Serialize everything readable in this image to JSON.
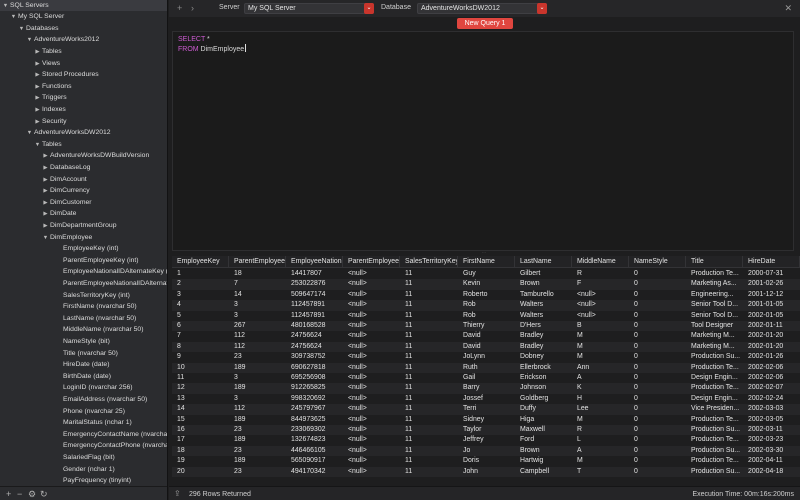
{
  "sidebar": {
    "tree": [
      {
        "label": "SQL Servers",
        "arrow": "▼",
        "indent": 0,
        "selected": true
      },
      {
        "label": "My SQL Server",
        "arrow": "▼",
        "indent": 1
      },
      {
        "label": "Databases",
        "arrow": "▼",
        "indent": 2
      },
      {
        "label": "AdventureWorks2012",
        "arrow": "▼",
        "indent": 3
      },
      {
        "label": "Tables",
        "arrow": "▶",
        "indent": 4
      },
      {
        "label": "Views",
        "arrow": "▶",
        "indent": 4
      },
      {
        "label": "Stored Procedures",
        "arrow": "▶",
        "indent": 4
      },
      {
        "label": "Functions",
        "arrow": "▶",
        "indent": 4
      },
      {
        "label": "Triggers",
        "arrow": "▶",
        "indent": 4
      },
      {
        "label": "Indexes",
        "arrow": "▶",
        "indent": 4
      },
      {
        "label": "Security",
        "arrow": "▶",
        "indent": 4
      },
      {
        "label": "AdventureWorksDW2012",
        "arrow": "▼",
        "indent": 3
      },
      {
        "label": "Tables",
        "arrow": "▼",
        "indent": 4
      },
      {
        "label": "AdventureWorksDWBuildVersion",
        "arrow": "▶",
        "indent": 5
      },
      {
        "label": "DatabaseLog",
        "arrow": "▶",
        "indent": 5
      },
      {
        "label": "DimAccount",
        "arrow": "▶",
        "indent": 5
      },
      {
        "label": "DimCurrency",
        "arrow": "▶",
        "indent": 5
      },
      {
        "label": "DimCustomer",
        "arrow": "▶",
        "indent": 5
      },
      {
        "label": "DimDate",
        "arrow": "▶",
        "indent": 5
      },
      {
        "label": "DimDepartmentGroup",
        "arrow": "▶",
        "indent": 5
      },
      {
        "label": "DimEmployee",
        "arrow": "▼",
        "indent": 5
      },
      {
        "label": "EmployeeKey (int)",
        "arrow": "",
        "indent": 6
      },
      {
        "label": "ParentEmployeeKey (int)",
        "arrow": "",
        "indent": 6
      },
      {
        "label": "EmployeeNationalIDAlternateKey (...",
        "arrow": "",
        "indent": 6
      },
      {
        "label": "ParentEmployeeNationalIDAlternat...",
        "arrow": "",
        "indent": 6
      },
      {
        "label": "SalesTerritoryKey (int)",
        "arrow": "",
        "indent": 6
      },
      {
        "label": "FirstName (nvarchar 50)",
        "arrow": "",
        "indent": 6
      },
      {
        "label": "LastName (nvarchar 50)",
        "arrow": "",
        "indent": 6
      },
      {
        "label": "MiddleName (nvarchar 50)",
        "arrow": "",
        "indent": 6
      },
      {
        "label": "NameStyle (bit)",
        "arrow": "",
        "indent": 6
      },
      {
        "label": "Title (nvarchar 50)",
        "arrow": "",
        "indent": 6
      },
      {
        "label": "HireDate (date)",
        "arrow": "",
        "indent": 6
      },
      {
        "label": "BirthDate (date)",
        "arrow": "",
        "indent": 6
      },
      {
        "label": "LoginID (nvarchar 256)",
        "arrow": "",
        "indent": 6
      },
      {
        "label": "EmailAddress (nvarchar 50)",
        "arrow": "",
        "indent": 6
      },
      {
        "label": "Phone (nvarchar 25)",
        "arrow": "",
        "indent": 6
      },
      {
        "label": "MaritalStatus (nchar 1)",
        "arrow": "",
        "indent": 6
      },
      {
        "label": "EmergencyContactName (nvarcha...",
        "arrow": "",
        "indent": 6
      },
      {
        "label": "EmergencyContactPhone (nvarcha...",
        "arrow": "",
        "indent": 6
      },
      {
        "label": "SalariedFlag (bit)",
        "arrow": "",
        "indent": 6
      },
      {
        "label": "Gender (nchar 1)",
        "arrow": "",
        "indent": 6
      },
      {
        "label": "PayFrequency (tinyint)",
        "arrow": "",
        "indent": 6
      }
    ],
    "bottom_icons": {
      "add": "+",
      "remove": "−",
      "settings": "⚙",
      "refresh": "↻"
    }
  },
  "toolbar": {
    "add_icon": "+",
    "forward_icon": "›",
    "server_label": "Server",
    "server_value": "My SQL Server",
    "database_label": "Database",
    "database_value": "AdventureWorksDW2012",
    "chevron": "⌄",
    "close_icon": "✕"
  },
  "query_tab": {
    "label": "New Query 1"
  },
  "editor": {
    "line1_kw": "SELECT",
    "line1_rest": " *",
    "line2_kw": "FROM",
    "line2_rest": " DimEmployee"
  },
  "results": {
    "columns": [
      "EmployeeKey",
      "ParentEmployee...",
      "EmployeeNation...",
      "ParentEmployee...",
      "SalesTerritoryKey",
      "FirstName",
      "LastName",
      "MiddleName",
      "NameStyle",
      "Title",
      "HireDate"
    ],
    "rows": [
      [
        "1",
        "18",
        "14417807",
        "<null>",
        "11",
        "Guy",
        "Gilbert",
        "R",
        "0",
        "Production Te...",
        "2000-07-31"
      ],
      [
        "2",
        "7",
        "253022876",
        "<null>",
        "11",
        "Kevin",
        "Brown",
        "F",
        "0",
        "Marketing As...",
        "2001-02-26"
      ],
      [
        "3",
        "14",
        "509647174",
        "<null>",
        "11",
        "Roberto",
        "Tamburello",
        "<null>",
        "0",
        "Engineering...",
        "2001-12-12"
      ],
      [
        "4",
        "3",
        "112457891",
        "<null>",
        "11",
        "Rob",
        "Walters",
        "<null>",
        "0",
        "Senior Tool D...",
        "2001-01-05"
      ],
      [
        "5",
        "3",
        "112457891",
        "<null>",
        "11",
        "Rob",
        "Walters",
        "<null>",
        "0",
        "Senior Tool D...",
        "2002-01-05"
      ],
      [
        "6",
        "267",
        "480168528",
        "<null>",
        "11",
        "Thierry",
        "D'Hers",
        "B",
        "0",
        "Tool Designer",
        "2002-01-11"
      ],
      [
        "7",
        "112",
        "24756624",
        "<null>",
        "11",
        "David",
        "Bradley",
        "M",
        "0",
        "Marketing M...",
        "2002-01-20"
      ],
      [
        "8",
        "112",
        "24756624",
        "<null>",
        "11",
        "David",
        "Bradley",
        "M",
        "0",
        "Marketing M...",
        "2002-01-20"
      ],
      [
        "9",
        "23",
        "309738752",
        "<null>",
        "11",
        "JoLynn",
        "Dobney",
        "M",
        "0",
        "Production Su...",
        "2002-01-26"
      ],
      [
        "10",
        "189",
        "690627818",
        "<null>",
        "11",
        "Ruth",
        "Ellerbrock",
        "Ann",
        "0",
        "Production Te...",
        "2002-02-06"
      ],
      [
        "11",
        "3",
        "695256908",
        "<null>",
        "11",
        "Gail",
        "Erickson",
        "A",
        "0",
        "Design Engin...",
        "2002-02-06"
      ],
      [
        "12",
        "189",
        "912265825",
        "<null>",
        "11",
        "Barry",
        "Johnson",
        "K",
        "0",
        "Production Te...",
        "2002-02-07"
      ],
      [
        "13",
        "3",
        "998320692",
        "<null>",
        "11",
        "Jossef",
        "Goldberg",
        "H",
        "0",
        "Design Engin...",
        "2002-02-24"
      ],
      [
        "14",
        "112",
        "245797967",
        "<null>",
        "11",
        "Terri",
        "Duffy",
        "Lee",
        "0",
        "Vice Presiden...",
        "2002-03-03"
      ],
      [
        "15",
        "189",
        "844973625",
        "<null>",
        "11",
        "Sidney",
        "Higa",
        "M",
        "0",
        "Production Te...",
        "2002-03-05"
      ],
      [
        "16",
        "23",
        "233069302",
        "<null>",
        "11",
        "Taylor",
        "Maxwell",
        "R",
        "0",
        "Production Su...",
        "2002-03-11"
      ],
      [
        "17",
        "189",
        "132674823",
        "<null>",
        "11",
        "Jeffrey",
        "Ford",
        "L",
        "0",
        "Production Te...",
        "2002-03-23"
      ],
      [
        "18",
        "23",
        "446466105",
        "<null>",
        "11",
        "Jo",
        "Brown",
        "A",
        "0",
        "Production Su...",
        "2002-03-30"
      ],
      [
        "19",
        "189",
        "565090917",
        "<null>",
        "11",
        "Doris",
        "Hartwig",
        "M",
        "0",
        "Production Te...",
        "2002-04-11"
      ],
      [
        "20",
        "23",
        "494170342",
        "<null>",
        "11",
        "John",
        "Campbell",
        "T",
        "0",
        "Production Su...",
        "2002-04-18"
      ]
    ]
  },
  "status": {
    "share_icon": "⇪",
    "rows_returned": "296 Rows Returned",
    "execution_time": "Execution Time: 00m:16s:200ms"
  }
}
